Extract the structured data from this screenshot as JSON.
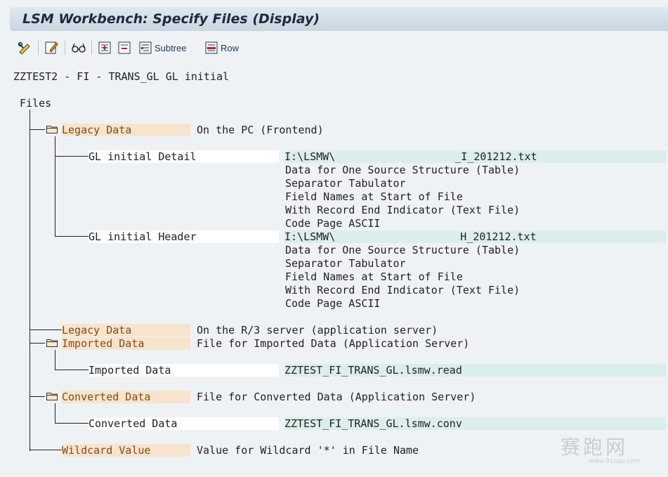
{
  "window": {
    "title": "LSM Workbench: Specify Files (Display)"
  },
  "toolbar": {
    "subtree_label": "Subtree",
    "row_label": "Row"
  },
  "header": {
    "object_text": "ZZTEST2 - FI - TRANS_GL GL initial"
  },
  "tree": {
    "root_label": "Files",
    "legacy_pc": {
      "label": "Legacy Data",
      "desc": "On the PC (Frontend)"
    },
    "gl_detail": {
      "label": "GL initial Detail",
      "path": "I:\\LSMW\\",
      "path_end": "_I_201212.txt",
      "props": [
        "Data for One Source Structure (Table)",
        "Separator Tabulator",
        "Field Names at Start of File",
        "With Record End Indicator (Text File)",
        "Code Page ASCII"
      ]
    },
    "gl_header": {
      "label": "GL initial Header",
      "path": "I:\\LSMW\\",
      "path_end": "H_201212.txt",
      "props": [
        "Data for One Source Structure (Table)",
        "Separator Tabulator",
        "Field Names at Start of File",
        "With Record End Indicator (Text File)",
        "Code Page ASCII"
      ]
    },
    "legacy_r3": {
      "label": "Legacy Data",
      "desc": "On the R/3 server (application server)"
    },
    "imported": {
      "label": "Imported Data",
      "desc": "File for Imported Data (Application Server)",
      "child_label": "Imported Data",
      "child_value": "ZZTEST_FI_TRANS_GL.lsmw.read"
    },
    "converted": {
      "label": "Converted Data",
      "desc": "File for Converted Data (Application Server)",
      "child_label": "Converted Data",
      "child_value": "ZZTEST_FI_TRANS_GL.lsmw.conv"
    },
    "wildcard": {
      "label": "Wildcard Value",
      "desc": "Value for Wildcard '*' in File Name"
    }
  },
  "watermark": {
    "main": "赛跑网",
    "sub": "www.91sap.com"
  },
  "colors": {
    "beige": "#f7e4cd",
    "teal": "#dbeeea",
    "background": "#eef2f5"
  },
  "icons": [
    "change-display-icon",
    "edit-icon",
    "glasses-icon",
    "expand-subtree-icon",
    "collapse-subtree-icon",
    "subtree-icon",
    "row-icon",
    "folder-icon"
  ]
}
